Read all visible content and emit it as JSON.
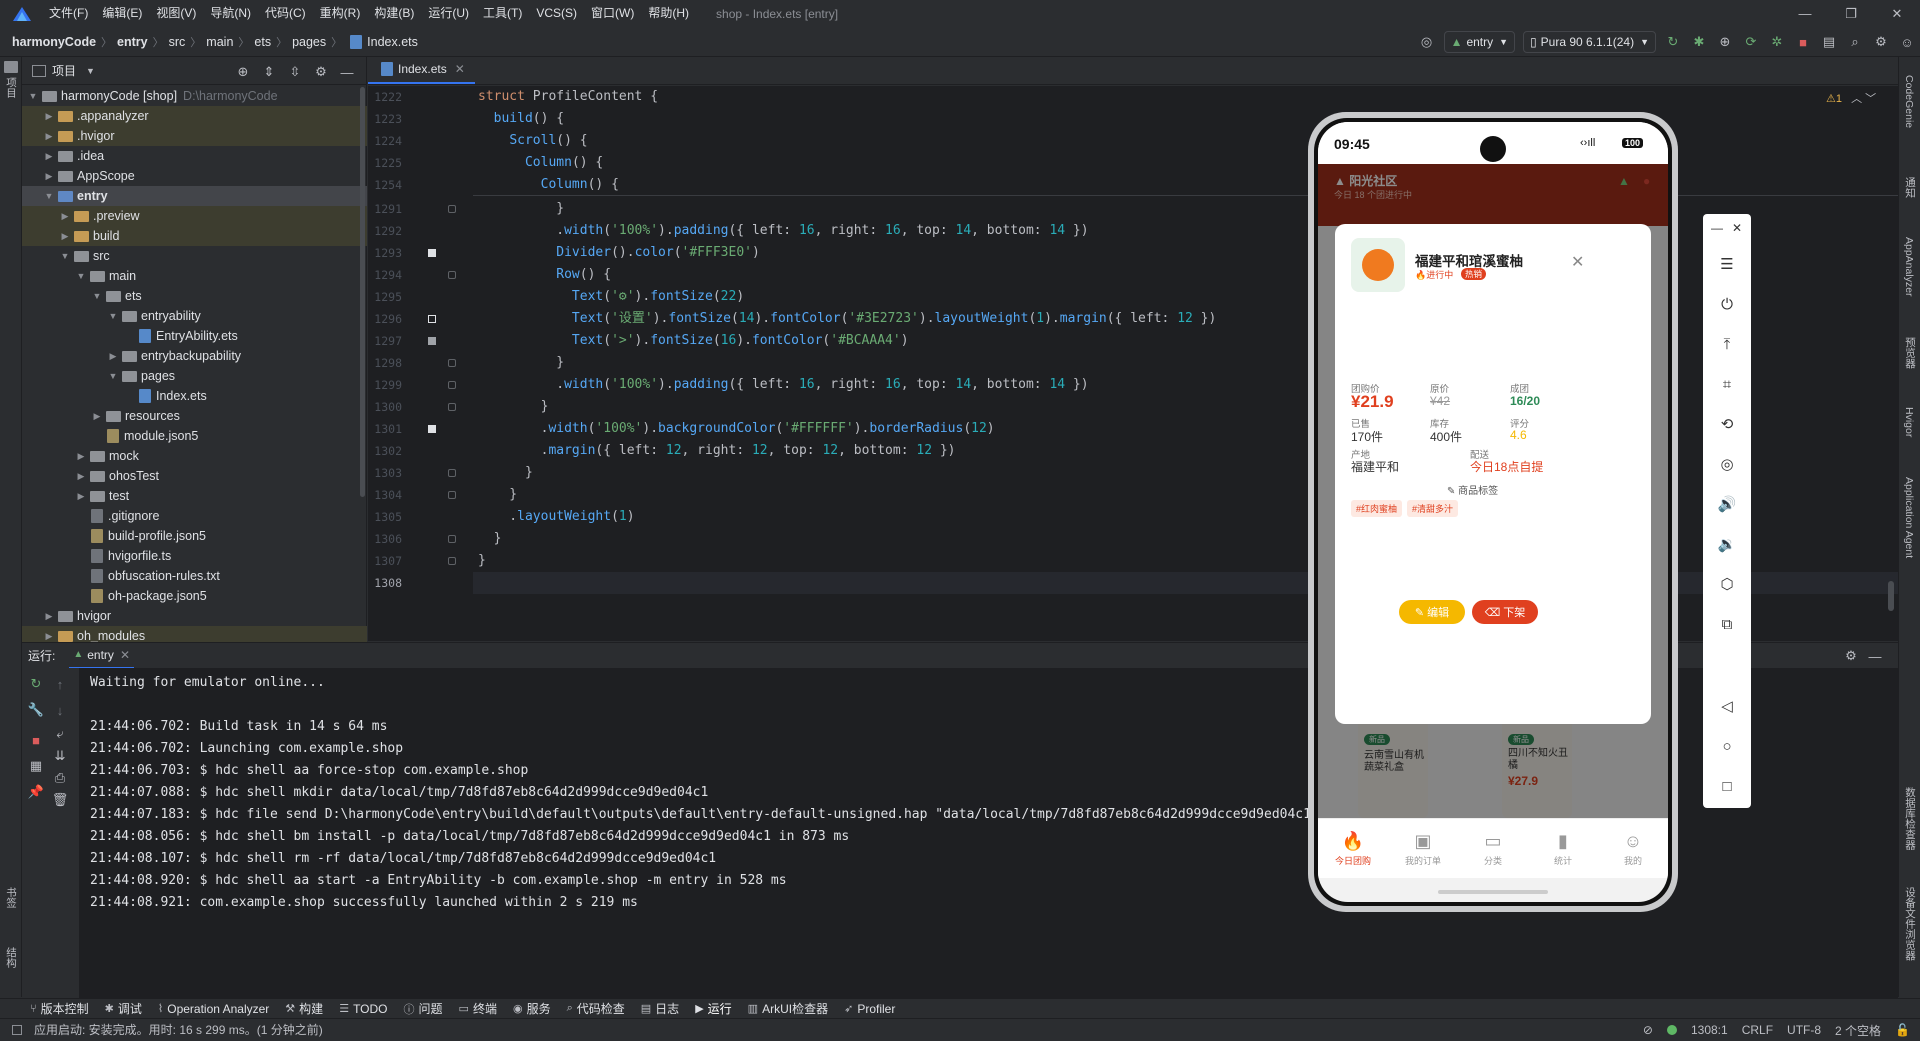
{
  "menu": {
    "items": [
      "文件(F)",
      "编辑(E)",
      "视图(V)",
      "导航(N)",
      "代码(C)",
      "重构(R)",
      "构建(B)",
      "运行(U)",
      "工具(T)",
      "VCS(S)",
      "窗口(W)",
      "帮助(H)"
    ],
    "window_title": "shop - Index.ets [entry]"
  },
  "breadcrumb": [
    "harmonyCode",
    "entry",
    "src",
    "main",
    "ets",
    "pages",
    "Index.ets"
  ],
  "toolbar": {
    "run_config": "entry",
    "device": "Pura 90 6.1.1(24)"
  },
  "project": {
    "header": "项目",
    "root_name": "harmonyCode [shop]",
    "root_path": "D:\\harmonyCode",
    "items": [
      ".appanalyzer",
      ".hvigor",
      ".idea",
      "AppScope",
      "entry",
      ".preview",
      "build",
      "src",
      "main",
      "ets",
      "entryability",
      "EntryAbility.ets",
      "entrybackupability",
      "pages",
      "Index.ets",
      "resources",
      "module.json5",
      "mock",
      "ohosTest",
      "test",
      ".gitignore",
      "build-profile.json5",
      "hvigorfile.ts",
      "obfuscation-rules.txt",
      "oh-package.json5",
      "hvigor",
      "oh_modules"
    ]
  },
  "editor": {
    "tab": "Index.ets",
    "problems": "1",
    "line_numbers": [
      "1222",
      "1223",
      "1224",
      "1225",
      "1254",
      "1291",
      "1292",
      "1293",
      "1294",
      "1295",
      "1296",
      "1297",
      "1298",
      "1299",
      "1300",
      "1301",
      "1302",
      "1303",
      "1304",
      "1305",
      "1306",
      "1307",
      "1308"
    ]
  },
  "run": {
    "label": "运行:",
    "tab": "entry",
    "console": [
      "Waiting for emulator online...",
      "",
      "21:44:06.702: Build task in 14 s 64 ms",
      "21:44:06.702: Launching com.example.shop",
      "21:44:06.703: $ hdc shell aa force-stop com.example.shop",
      "21:44:07.088: $ hdc shell mkdir data/local/tmp/7d8fd87eb8c64d2d999dcce9d9ed04c1",
      "21:44:07.183: $ hdc file send D:\\harmonyCode\\entry\\build\\default\\outputs\\default\\entry-default-unsigned.hap \"data/local/tmp/7d8fd87eb8c64d2d999dcce9d9ed04c1\"",
      "21:44:08.056: $ hdc shell bm install -p data/local/tmp/7d8fd87eb8c64d2d999dcce9d9ed04c1 in 873 ms",
      "21:44:08.107: $ hdc shell rm -rf data/local/tmp/7d8fd87eb8c64d2d999dcce9d9ed04c1",
      "21:44:08.920: $ hdc shell aa start -a EntryAbility -b com.example.shop -m entry in 528 ms",
      "21:44:08.921: com.example.shop successfully launched within 2 s 219 ms"
    ]
  },
  "bottom_tools": [
    "版本控制",
    "调试",
    "Operation Analyzer",
    "构建",
    "TODO",
    "问题",
    "终端",
    "服务",
    "代码检查",
    "日志",
    "运行",
    "ArkUI检查器",
    "Profiler"
  ],
  "status": {
    "message": "应用启动: 安装完成。用时: 16 s 299 ms。(1 分钟之前)",
    "position": "1308:1",
    "line_sep": "CRLF",
    "encoding": "UTF-8",
    "indent": "2 个空格"
  },
  "left_stripe": {
    "top": "项目",
    "bottom1": "书签",
    "bottom2": "结构"
  },
  "right_stripe": [
    "CodeGenie",
    "通知",
    "AppAnalyzer",
    "预览器",
    "Hvigor",
    "Application Agent",
    "数据库检查器",
    "设备文件浏览器"
  ],
  "phone": {
    "time": "09:45",
    "battery": "100",
    "community": "阳光社区",
    "community_sub": "今日 18 个团进行中",
    "product": {
      "name": "福建平和琯溪蜜柚",
      "status": "进行中",
      "hot": "热销",
      "group_price_label": "团购价",
      "group_price": "¥21.9",
      "orig_price_label": "原价",
      "orig_price": "¥42",
      "formed_label": "成团",
      "formed": "16/20",
      "sold_label": "已售",
      "sold": "170件",
      "stock_label": "库存",
      "stock": "400件",
      "rating_label": "评分",
      "rating": "4.6",
      "origin_label": "产地",
      "origin": "福建平和",
      "delivery_label": "配送",
      "delivery": "今日18点自提",
      "tags_label": "商品标签",
      "tags": [
        "#红肉蜜柚",
        "#清甜多汁"
      ],
      "edit_btn": "编辑",
      "off_btn": "下架"
    },
    "bg_cards": [
      {
        "badge": "新品",
        "name": "云南雪山有机蔬菜礼盒"
      },
      {
        "badge": "新品",
        "name": "四川不知火丑橘",
        "price": "¥27.9"
      }
    ],
    "tabs": [
      "今日团购",
      "我的订单",
      "分类",
      "统计",
      "我的"
    ]
  },
  "colors": {
    "accent": "#3574f0",
    "app_red": "#a4311d",
    "price_red": "#e0401f",
    "formed_green": "#2e8b57",
    "edit_yellow": "#f5b800",
    "off_red": "#e0401f"
  }
}
